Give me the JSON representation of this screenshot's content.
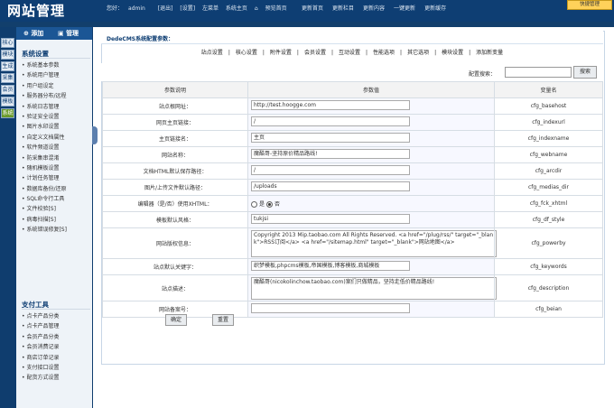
{
  "header": {
    "logo": "网站管理",
    "greeting": "您好：",
    "user": "admin",
    "logout": "[退出]",
    "settings": "[设置]",
    "left_menu": "左菜单",
    "site_home": "系统主页",
    "preview": "预览首页",
    "quick_menu": "快捷管理"
  },
  "topnav": [
    "更新首页",
    "更新栏目",
    "更新内容",
    "一键更新",
    "更新缓存"
  ],
  "sidetabs": [
    "核心",
    "模块",
    "生成",
    "采集",
    "会员",
    "模板",
    "系统"
  ],
  "nav_buttons": {
    "add": "添加",
    "manage": "管理"
  },
  "sections": [
    {
      "title": "系统设置",
      "items": [
        "系统基本参数",
        "系统用户管理",
        "用户组设定",
        "服务器分布/远程",
        "系统日志管理",
        "验证安全设置",
        "图片水印设置",
        "自定义文档属性",
        "软件频道设置",
        "防采集串混淆",
        "随机模板设置",
        "计划任务管理",
        "数据库备份/还原",
        "SQL命令行工具",
        "文件校验[S]",
        "病毒扫描[S]",
        "系统错误修复[S]"
      ]
    },
    {
      "title": "支付工具",
      "items": [
        "点卡产品分类",
        "点卡产品管理",
        "会员产品分类",
        "会员消费记录",
        "商店订单记录",
        "支付接口设置",
        "配货方式设置"
      ]
    }
  ],
  "config": {
    "title": "DedeCMS系统配置参数：",
    "tabs": [
      "站点设置",
      "核心设置",
      "附件设置",
      "会员设置",
      "互动设置",
      "性能选项",
      "其它选项",
      "模块设置",
      "添加新变量"
    ],
    "search_label": "配置搜索：",
    "search_button": "搜索",
    "columns": [
      "参数说明",
      "参数值",
      "变量名"
    ],
    "rows": [
      {
        "label": "站点根网址：",
        "value": "http://test.hoogge.com",
        "var": "cfg_basehost",
        "type": "input"
      },
      {
        "label": "网页主页链接：",
        "value": "/",
        "var": "cfg_indexurl",
        "type": "input"
      },
      {
        "label": "主页链接名：",
        "value": "主页",
        "var": "cfg_indexname",
        "type": "input"
      },
      {
        "label": "网站名称：",
        "value": "魔酷哥-坚持原价精品路线!",
        "var": "cfg_webname",
        "type": "input"
      },
      {
        "label": "文档HTML默认保存路径：",
        "value": "/",
        "var": "cfg_arcdir",
        "type": "input"
      },
      {
        "label": "图片/上传文件默认路径：",
        "value": "/uploads",
        "var": "cfg_medias_dir",
        "type": "input"
      },
      {
        "label": "编辑器（是/否）使用XHTML：",
        "var": "cfg_fck_xhtml",
        "type": "radio",
        "opt_yes": "是",
        "opt_no": "否"
      },
      {
        "label": "模板默认风格：",
        "value": "tukjsi",
        "var": "cfg_df_style",
        "type": "input"
      },
      {
        "label": "网站版权信息：",
        "value": "Copyright 2013 Mip.taobao.com All Rights Reserved. <a href=\"/plug/rss/\" target=\"_blank\">RSS订阅</a> <a href=\"/sitemap.html\" target=\"_blank\">网站地图</a>",
        "var": "cfg_powerby",
        "type": "textarea"
      },
      {
        "label": "站点默认关键字：",
        "value": "织梦模板,phpcms模板,帝国模板,博客模板,商城模板",
        "var": "cfg_keywords",
        "type": "input"
      },
      {
        "label": "站点描述：",
        "value": "魔酷哥(nicokolinchow.taobao.com)案们只做精品，坚持走低价精品路线!",
        "var": "cfg_description",
        "type": "textarea"
      },
      {
        "label": "网站备案号：",
        "value": "",
        "var": "cfg_beian",
        "type": "input"
      }
    ],
    "ok_button": "确定",
    "reset_button": "重置"
  }
}
